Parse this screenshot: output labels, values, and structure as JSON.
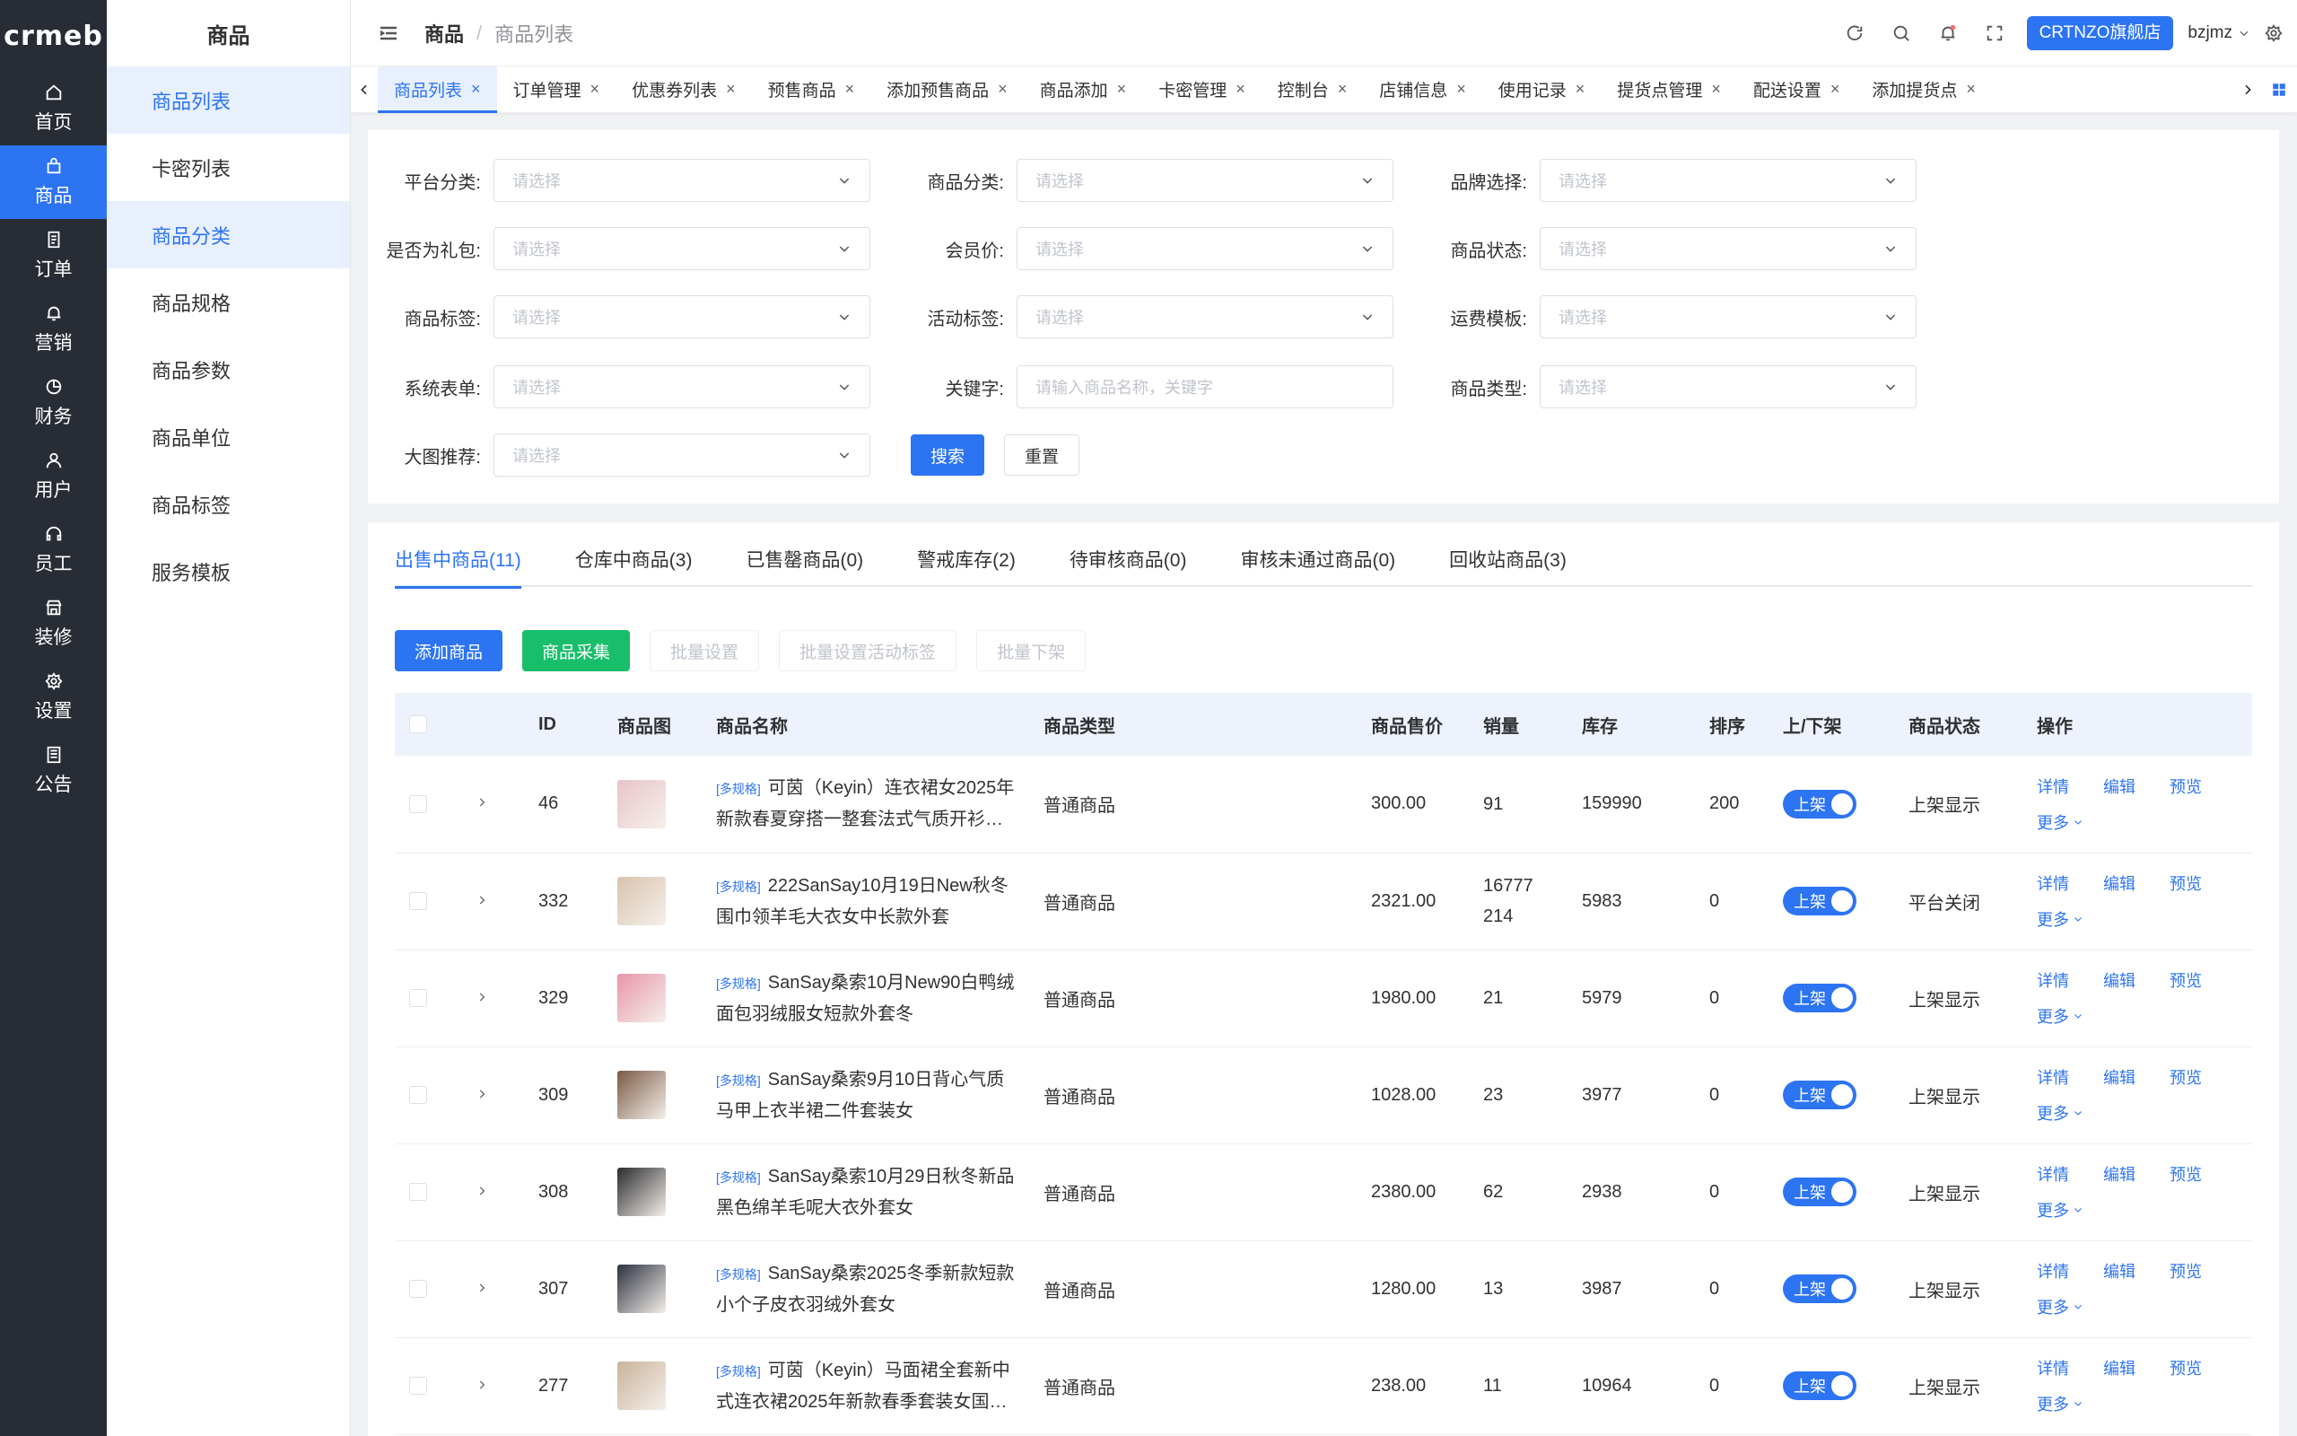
{
  "rail": {
    "logo": "crmeb",
    "items": [
      {
        "label": "首页",
        "icon": "home-icon"
      },
      {
        "label": "商品",
        "icon": "bag-icon"
      },
      {
        "label": "订单",
        "icon": "order-icon"
      },
      {
        "label": "营销",
        "icon": "bell-icon"
      },
      {
        "label": "财务",
        "icon": "pie-icon"
      },
      {
        "label": "用户",
        "icon": "user-icon"
      },
      {
        "label": "员工",
        "icon": "headset-icon"
      },
      {
        "label": "装修",
        "icon": "shop-icon"
      },
      {
        "label": "设置",
        "icon": "gear-icon"
      },
      {
        "label": "公告",
        "icon": "notice-icon"
      }
    ]
  },
  "submenu": {
    "title": "商品",
    "items": [
      "商品列表",
      "卡密列表",
      "商品分类",
      "商品规格",
      "商品参数",
      "商品单位",
      "商品标签",
      "服务模板"
    ]
  },
  "header": {
    "breadcrumb_root": "商品",
    "breadcrumb_sep": "/",
    "breadcrumb_current": "商品列表",
    "shop_button": "CRTNZO旗舰店",
    "user": "bzjmz"
  },
  "tags": [
    "商品列表",
    "订单管理",
    "优惠券列表",
    "预售商品",
    "添加预售商品",
    "商品添加",
    "卡密管理",
    "控制台",
    "店铺信息",
    "使用记录",
    "提货点管理",
    "配送设置",
    "添加提货点"
  ],
  "filters": {
    "labels": [
      "平台分类:",
      "商品分类:",
      "品牌选择:",
      "是否为礼包:",
      "会员价:",
      "商品状态:",
      "商品标签:",
      "活动标签:",
      "运费模板:",
      "系统表单:",
      "关键字:",
      "商品类型:",
      "大图推荐:"
    ],
    "placeholder": "请选择",
    "keyword_placeholder": "请输入商品名称，关键字",
    "search": "搜索",
    "reset": "重置"
  },
  "product_tabs": [
    "出售中商品(11)",
    "仓库中商品(3)",
    "已售罄商品(0)",
    "警戒库存(2)",
    "待审核商品(0)",
    "审核未通过商品(0)",
    "回收站商品(3)"
  ],
  "action_buttons": {
    "add": "添加商品",
    "collect": "商品采集",
    "batch_set": "批量设置",
    "batch_tag": "批量设置活动标签",
    "batch_off": "批量下架"
  },
  "table": {
    "columns": [
      "ID",
      "商品图",
      "商品名称",
      "商品类型",
      "商品售价",
      "销量",
      "库存",
      "排序",
      "上/下架",
      "商品状态",
      "操作"
    ],
    "spec_tag": "[多规格]",
    "switch_label": "上架",
    "ops": {
      "detail": "详情",
      "edit": "编辑",
      "preview": "预览",
      "more": "更多"
    },
    "rows": [
      {
        "id": "46",
        "name": "可茵（Keyin）连衣裙女2025年新款春夏穿搭一整套法式气质开衫…",
        "type": "普通商品",
        "price": "300.00",
        "sales": "91",
        "stock": "159990",
        "sort": "200",
        "status": "上架显示",
        "thumb": "#e8c4c8"
      },
      {
        "id": "332",
        "name": "222SanSay10月19日New秋冬围巾领羊毛大衣女中长款外套",
        "type": "普通商品",
        "price": "2321.00",
        "sales": "16777214",
        "stock": "5983",
        "sort": "0",
        "status": "平台关闭",
        "thumb": "#d9c3ae"
      },
      {
        "id": "329",
        "name": "SanSay桑索10月New90白鸭绒面包羽绒服女短款外套冬",
        "type": "普通商品",
        "price": "1980.00",
        "sales": "21",
        "stock": "5979",
        "sort": "0",
        "status": "上架显示",
        "thumb": "#e994a8"
      },
      {
        "id": "309",
        "name": "SanSay桑索9月10日背心气质马甲上衣半裙二件套装女",
        "type": "普通商品",
        "price": "1028.00",
        "sales": "23",
        "stock": "3977",
        "sort": "0",
        "status": "上架显示",
        "thumb": "#7a5a45"
      },
      {
        "id": "308",
        "name": "SanSay桑索10月29日秋冬新品黑色绵羊毛呢大衣外套女",
        "type": "普通商品",
        "price": "2380.00",
        "sales": "62",
        "stock": "2938",
        "sort": "0",
        "status": "上架显示",
        "thumb": "#2b2b2e"
      },
      {
        "id": "307",
        "name": "SanSay桑索2025冬季新款短款小个子皮衣羽绒外套女",
        "type": "普通商品",
        "price": "1280.00",
        "sales": "13",
        "stock": "3987",
        "sort": "0",
        "status": "上架显示",
        "thumb": "#2d3140"
      },
      {
        "id": "277",
        "name": "可茵（Keyin）马面裙全套新中式连衣裙2025年新款春季套装女国…",
        "type": "普通商品",
        "price": "238.00",
        "sales": "11",
        "stock": "10964",
        "sort": "0",
        "status": "上架显示",
        "thumb": "#c9b29a"
      }
    ]
  },
  "colors": {
    "accent": "#2d74f3",
    "rail_bg": "#282c34",
    "green": "#19be6b"
  }
}
